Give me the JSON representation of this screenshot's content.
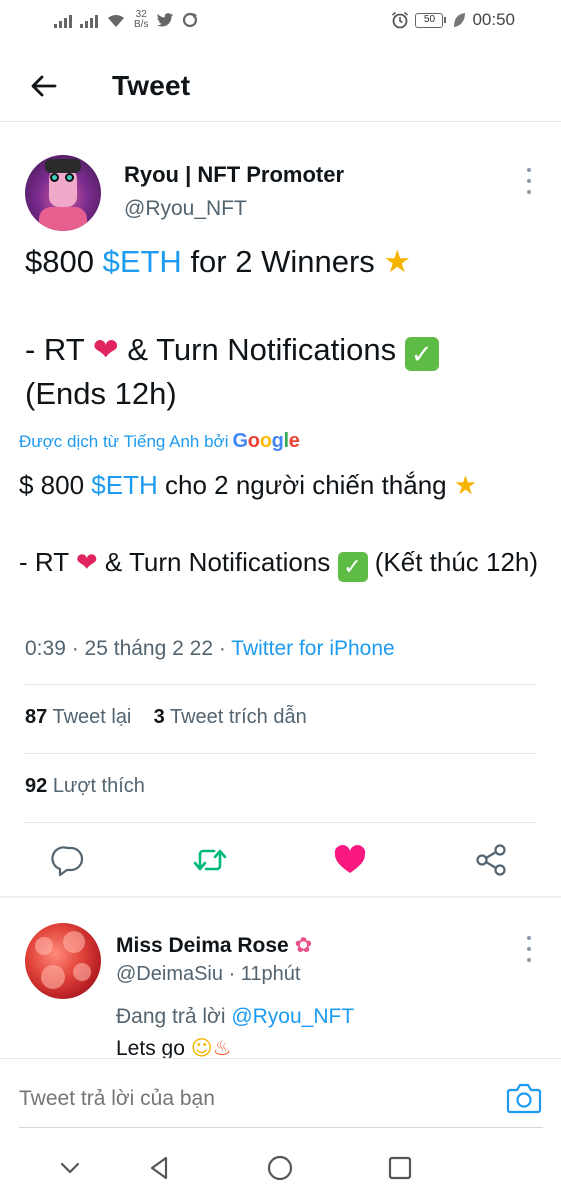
{
  "status_bar": {
    "net_speed_value": "32",
    "net_speed_unit": "B/s",
    "battery": "50",
    "time": "00:50",
    "icons": [
      "signal-icon",
      "signal-icon",
      "wifi-icon",
      "twitter-icon",
      "sync-icon",
      "alarm-icon",
      "battery-icon",
      "leaf-icon"
    ]
  },
  "header": {
    "title": "Tweet"
  },
  "tweet": {
    "author_name": "Ryou | NFT Promoter",
    "author_handle": "@Ryou_NFT",
    "line1_amount": "$800 ",
    "line1_tag": "$ETH",
    "line1_rest": " for 2 Winners ",
    "line2_a": "- RT ",
    "line2_b": " & Turn Notifications ",
    "line3": "(Ends 12h)",
    "translated_by_label": "Được dịch từ Tiếng Anh bởi",
    "translated_line1_a": "$ 800 ",
    "translated_tag": "$ETH",
    "translated_line1_b": " cho 2 người chiến thắng ",
    "translated_line2_a": " - RT ",
    "translated_line2_b": " & Turn Notifications ",
    "translated_line2_c": " (Kết thúc 12h)",
    "time": "0:39",
    "date": "25 tháng 2 22",
    "source": "Twitter for iPhone",
    "retweets_count": "87",
    "retweets_label": "Tweet lại",
    "quotes_count": "3",
    "quotes_label": "Tweet trích dẫn",
    "likes_count": "92",
    "likes_label": "Lượt thích",
    "liked": true,
    "colors": {
      "link": "#1d9bf0",
      "retweet": "#00ba7c",
      "like": "#f91880"
    }
  },
  "google_logo": "Google",
  "reply": {
    "author_name": "Miss Deima Rose",
    "author_handle": "@DeimaSiu",
    "time": "11phút",
    "replying_label": "Đang trả lời",
    "replying_to": "@Ryou_NFT",
    "text": "Lets go"
  },
  "compose": {
    "placeholder": "Tweet trả lời của bạn"
  },
  "nav": {
    "buttons": [
      "chevron-down-icon",
      "back-triangle-icon",
      "home-circle-icon",
      "recents-square-icon"
    ]
  }
}
